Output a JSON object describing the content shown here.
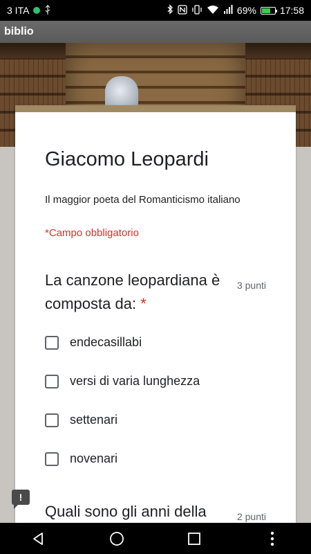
{
  "status_bar": {
    "carrier": "3 ITA",
    "battery_percent": "69%",
    "battery_level": 0.69,
    "time": "17:58",
    "icons": [
      "usb-icon",
      "bluetooth-icon",
      "nfc-icon",
      "vibrate-icon",
      "wifi-icon",
      "signal-icon",
      "battery-icon"
    ]
  },
  "app_bar": {
    "title": "biblio"
  },
  "form": {
    "title": "Giacomo Leopardi",
    "description": "Il maggior poeta del Romanticismo italiano",
    "required_note": "*Campo obbligatorio",
    "questions": [
      {
        "text": "La canzone leopardiana è composta da:",
        "required_mark": "*",
        "points": "3 punti",
        "options": [
          "endecasillabi",
          "versi di varia lunghezza",
          "settenari",
          "novenari"
        ]
      },
      {
        "text": "Quali sono gli anni della",
        "points": "2 punti"
      }
    ]
  },
  "feedback_icon": {
    "symbol": "!",
    "name": "feedback-icon"
  },
  "nav_bar": {
    "icons": [
      "back-icon",
      "home-icon",
      "recents-icon",
      "more-vert-icon"
    ]
  },
  "colors": {
    "accent_bar": "#a08a63",
    "required": "#d93025",
    "battery_fill": "#35d04a"
  }
}
